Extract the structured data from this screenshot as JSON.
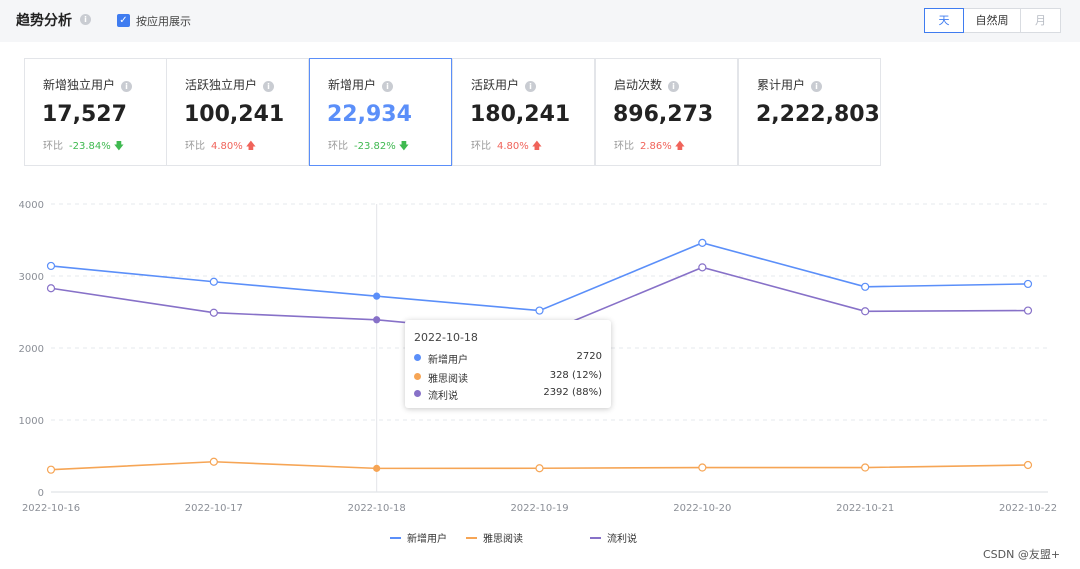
{
  "header": {
    "title": "趋势分析",
    "checkbox_label": "按应用展示",
    "checkbox_checked": true,
    "segments": [
      "天",
      "自然周",
      "月"
    ],
    "active_segment": "天"
  },
  "cards": [
    {
      "label": "新增独立用户",
      "value": "17,527",
      "change_label": "环比",
      "change": "-23.84%",
      "direction": "down"
    },
    {
      "label": "活跃独立用户",
      "value": "100,241",
      "change_label": "环比",
      "change": "4.80%",
      "direction": "up"
    },
    {
      "label": "新增用户",
      "value": "22,934",
      "change_label": "环比",
      "change": "-23.82%",
      "direction": "down",
      "active": true
    },
    {
      "label": "活跃用户",
      "value": "180,241",
      "change_label": "环比",
      "change": "4.80%",
      "direction": "up"
    },
    {
      "label": "启动次数",
      "value": "896,273",
      "change_label": "环比",
      "change": "2.86%",
      "direction": "up"
    },
    {
      "label": "累计用户",
      "value": "2,222,803"
    }
  ],
  "chart_data": {
    "type": "line",
    "x": [
      "2022-10-16",
      "2022-10-17",
      "2022-10-18",
      "2022-10-19",
      "2022-10-20",
      "2022-10-21",
      "2022-10-22"
    ],
    "yticks": [
      0,
      1000,
      2000,
      3000,
      4000
    ],
    "ylim": [
      0,
      4000
    ],
    "grid": true,
    "legend_position": "bottom",
    "series": [
      {
        "name": "新增用户",
        "color": "#5b8ff9",
        "values": [
          3140,
          2920,
          2720,
          2520,
          3460,
          2850,
          2890
        ]
      },
      {
        "name": "雅思阅读",
        "color": "#f6a555",
        "values": [
          310,
          420,
          328,
          330,
          340,
          340,
          375
        ]
      },
      {
        "name": "流利说",
        "color": "#8771c8",
        "values": [
          2830,
          2490,
          2392,
          2180,
          3120,
          2510,
          2520
        ]
      }
    ],
    "tooltip": {
      "date": "2022-10-18",
      "rows": [
        {
          "name": "新增用户",
          "value": "2720",
          "color": "#5b8ff9"
        },
        {
          "name": "雅思阅读",
          "value": "328 (12%)",
          "color": "#f6a555"
        },
        {
          "name": "流利说",
          "value": "2392 (88%)",
          "color": "#8771c8"
        }
      ]
    }
  },
  "watermark": "CSDN @友盟+"
}
